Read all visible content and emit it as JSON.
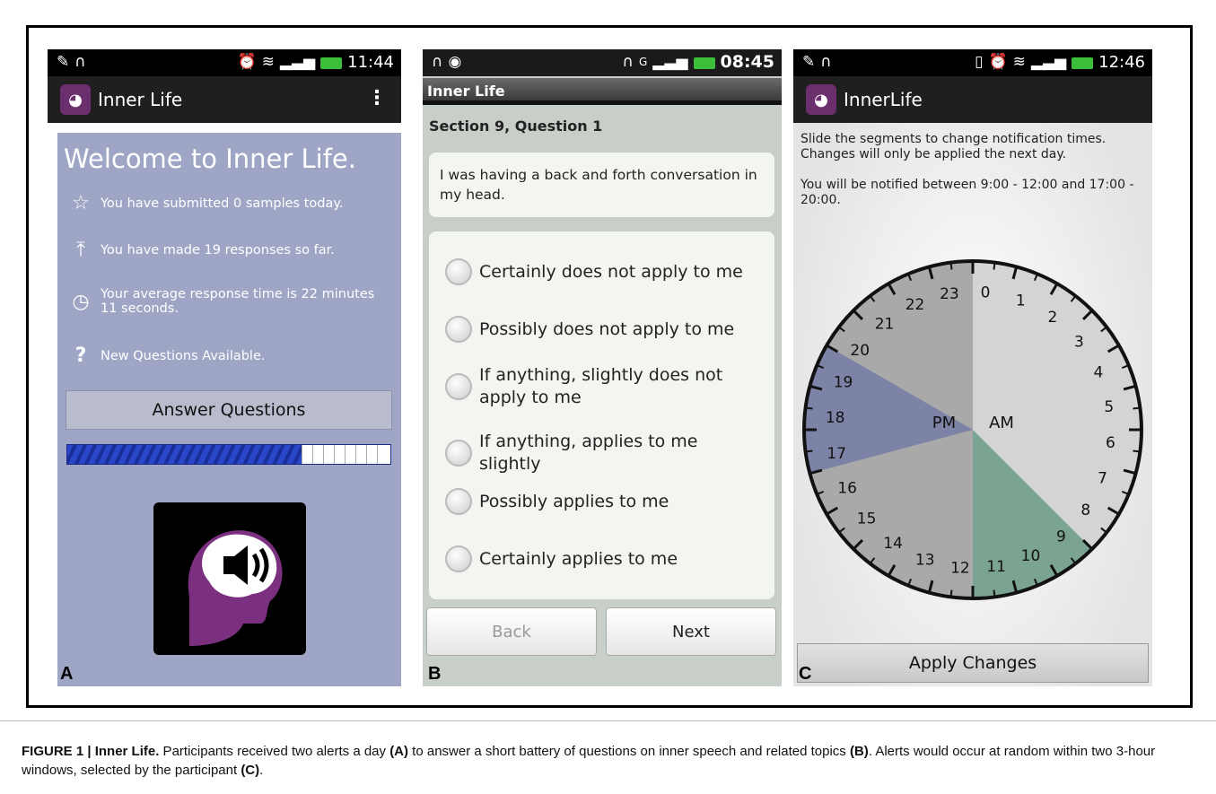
{
  "panels": {
    "A": {
      "status_time": "11:44",
      "app_title": "Inner Life",
      "welcome": "Welcome to Inner Life.",
      "rows": [
        {
          "icon": "star-icon",
          "text": "You have submitted 0 samples today."
        },
        {
          "icon": "upload-icon",
          "text": "You have made 19 responses so far."
        },
        {
          "icon": "clock-icon",
          "text": "Your average response time is 22 minutes 11 seconds."
        },
        {
          "icon": "question-icon",
          "text": "New Questions Available."
        }
      ],
      "button": "Answer Questions",
      "progress_fraction": 0.72,
      "letter": "A"
    },
    "B": {
      "status_time": "08:45",
      "app_title": "Inner Life",
      "section": "Section  9, Question 1",
      "question": "I was having a back and forth conversation in my head.",
      "options": [
        "Certainly does not apply to me",
        "Possibly does not apply to me",
        "If anything, slightly does not apply to me",
        "If anything, applies to me slightly",
        "Possibly applies to me",
        "Certainly applies to me"
      ],
      "back": "Back",
      "next": "Next",
      "letter": "B"
    },
    "C": {
      "status_time": "12:46",
      "app_title": "InnerLife",
      "desc1": "Slide the segments to change notification times. Changes will only be applied the next day.",
      "desc2": "You will be notified between 9:00 - 12:00 and 17:00 - 20:00.",
      "pm": "PM",
      "am": "AM",
      "hours": [
        "0",
        "1",
        "2",
        "3",
        "4",
        "5",
        "6",
        "7",
        "8",
        "9",
        "10",
        "11",
        "12",
        "13",
        "14",
        "15",
        "16",
        "17",
        "18",
        "19",
        "20",
        "21",
        "22",
        "23"
      ],
      "windows": [
        {
          "start": 9,
          "end": 12,
          "color": "#7aa392"
        },
        {
          "start": 17,
          "end": 20,
          "color": "#7d83a6"
        }
      ],
      "apply": "Apply Changes",
      "letter": "C"
    }
  },
  "caption": {
    "label": "FIGURE 1 | Inner Life.",
    "t1": " Participants received two alerts a day ",
    "a": "(A)",
    "t2": " to answer a short battery of questions on inner speech and related topics ",
    "b": "(B)",
    "t3": ". Alerts would occur at random within two 3-hour windows, selected by the participant ",
    "c": "(C)",
    "t4": "."
  }
}
